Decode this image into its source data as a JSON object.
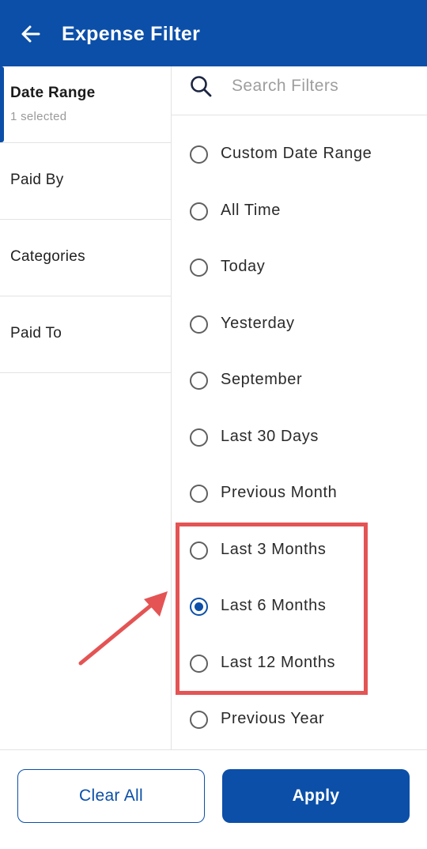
{
  "app_bar": {
    "title": "Expense Filter",
    "back_icon": "arrow-left-icon",
    "background_color": "#0b4fa8"
  },
  "sidebar": {
    "items": [
      {
        "label": "Date Range",
        "subtitle": "1 selected",
        "active": true
      },
      {
        "label": "Paid By",
        "active": false
      },
      {
        "label": "Categories",
        "active": false
      },
      {
        "label": "Paid To",
        "active": false
      }
    ]
  },
  "search": {
    "placeholder": "Search Filters",
    "value": "",
    "icon": "search-icon"
  },
  "options": [
    {
      "label": "Custom Date Range",
      "selected": false
    },
    {
      "label": "All Time",
      "selected": false
    },
    {
      "label": "Today",
      "selected": false
    },
    {
      "label": "Yesterday",
      "selected": false
    },
    {
      "label": "September",
      "selected": false
    },
    {
      "label": "Last 30 Days",
      "selected": false
    },
    {
      "label": "Previous Month",
      "selected": false
    },
    {
      "label": "Last 3 Months",
      "selected": false
    },
    {
      "label": "Last 6 Months",
      "selected": true
    },
    {
      "label": "Last 12 Months",
      "selected": false
    },
    {
      "label": "Previous Year",
      "selected": false
    }
  ],
  "annotation": {
    "highlight_color": "#e45454"
  },
  "footer": {
    "clear_label": "Clear All",
    "apply_label": "Apply"
  },
  "colors": {
    "accent": "#0b4fa8",
    "divider": "#e3e3e3"
  }
}
